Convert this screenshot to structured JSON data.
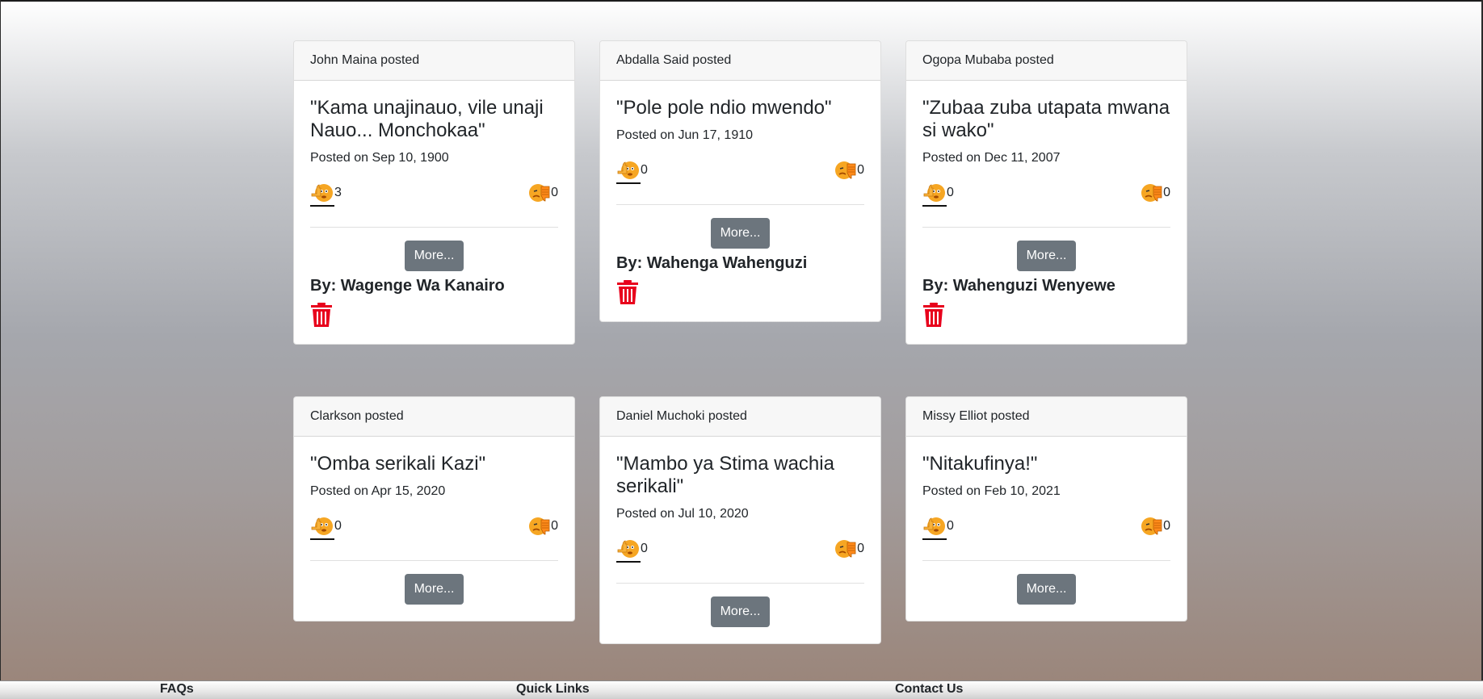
{
  "posts": [
    {
      "poster": "John Maina posted",
      "quote": "\"Kama unajinauo, vile unaji Nauo... Monchokaa\"",
      "date": "Posted on Sep 10, 1900",
      "likes": "3",
      "dislikes": "0",
      "more_label": "More...",
      "author": "By: Wagenge Wa Kanairo",
      "has_delete": true
    },
    {
      "poster": "Abdalla Said posted",
      "quote": "\"Pole pole ndio mwendo\"",
      "date": "Posted on Jun 17, 1910",
      "likes": "0",
      "dislikes": "0",
      "more_label": "More...",
      "author": "By: Wahenga Wahenguzi",
      "has_delete": true
    },
    {
      "poster": "Ogopa Mubaba posted",
      "quote": "\"Zubaa zuba utapata mwana si wako\"",
      "date": "Posted on Dec 11, 2007",
      "likes": "0",
      "dislikes": "0",
      "more_label": "More...",
      "author": "By: Wahenguzi Wenyewe",
      "has_delete": true
    },
    {
      "poster": "Clarkson posted",
      "quote": "\"Omba serikali Kazi\"",
      "date": "Posted on Apr 15, 2020",
      "likes": "0",
      "dislikes": "0",
      "more_label": "More...",
      "author": "",
      "has_delete": false
    },
    {
      "poster": "Daniel Muchoki posted",
      "quote": "\"Mambo ya Stima wachia serikali\"",
      "date": "Posted on Jul 10, 2020",
      "likes": "0",
      "dislikes": "0",
      "more_label": "More...",
      "author": "",
      "has_delete": false
    },
    {
      "poster": "Missy Elliot posted",
      "quote": "\"Nitakufinya!\"",
      "date": "Posted on Feb 10, 2021",
      "likes": "0",
      "dislikes": "0",
      "more_label": "More...",
      "author": "",
      "has_delete": false
    }
  ],
  "icons": {
    "like": "thumbs-up-emoji-icon",
    "dislike": "thumbs-down-emoji-icon",
    "delete": "trash-icon"
  },
  "colors": {
    "button": "#6c757d",
    "delete": "#e8001c",
    "emoji": "#f6a623"
  },
  "footer": {
    "faqs": "FAQs",
    "quick_links": "Quick Links",
    "contact": "Contact Us"
  }
}
